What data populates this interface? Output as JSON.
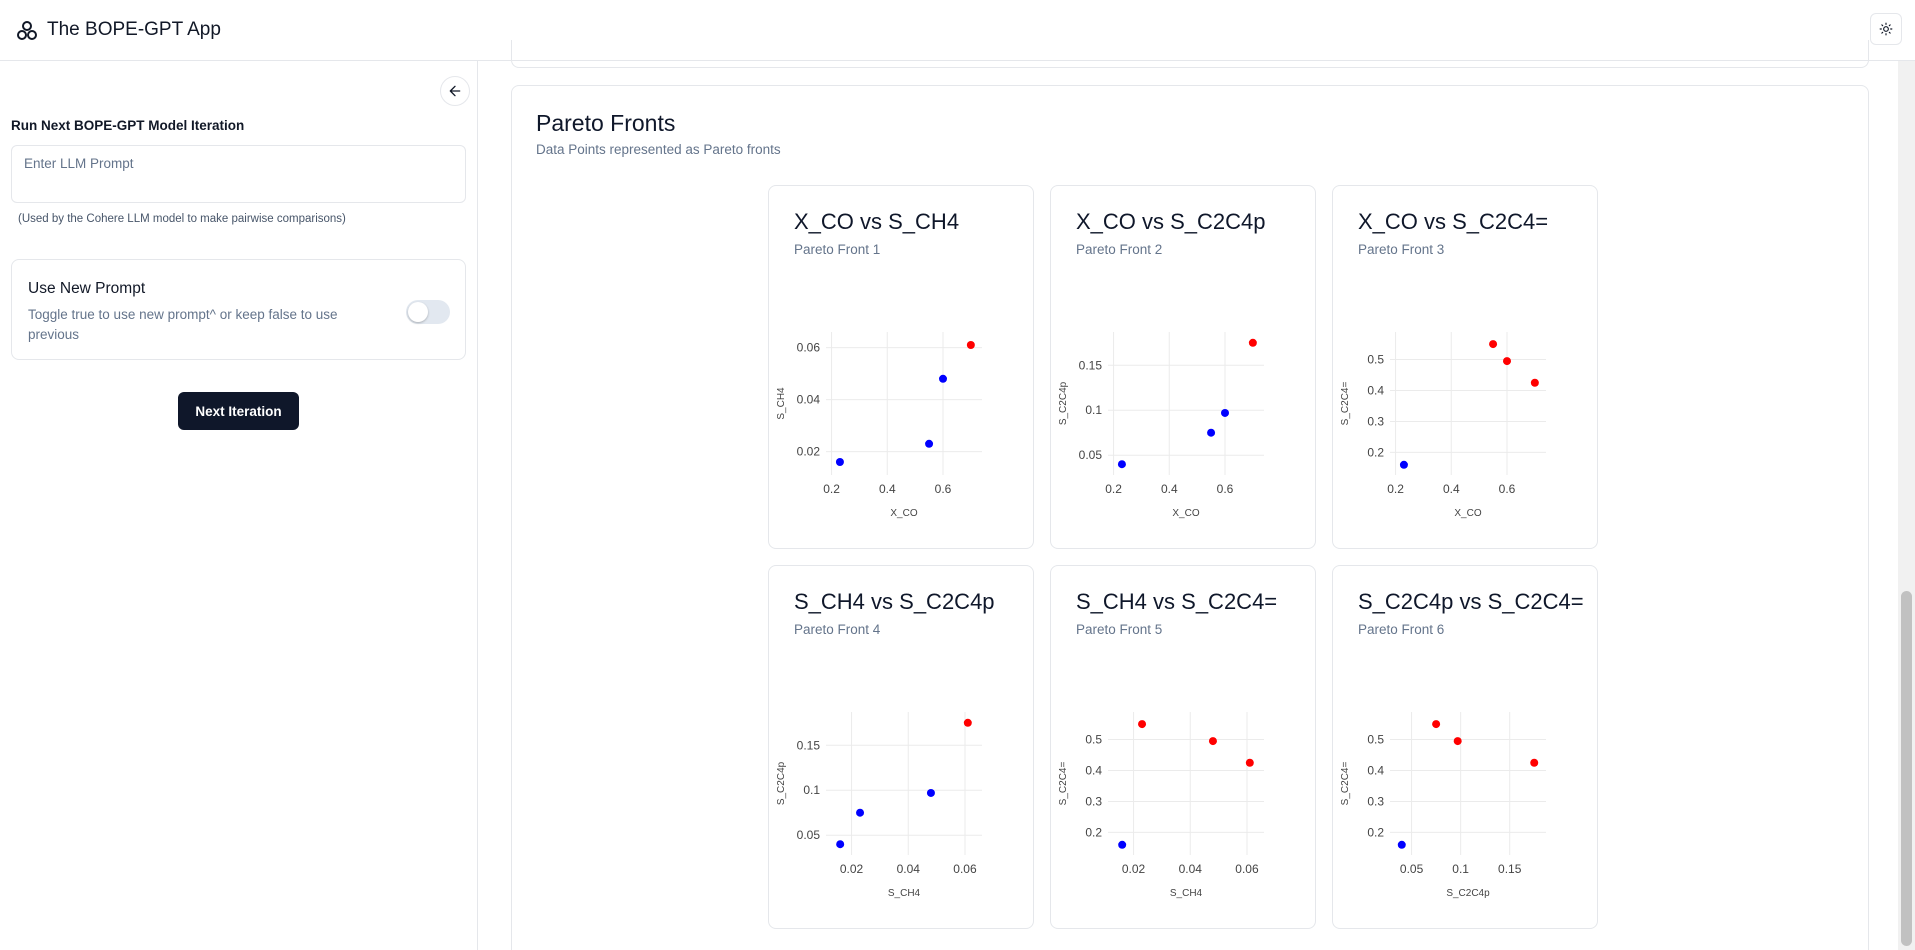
{
  "header": {
    "app_title": "The BOPE-GPT App",
    "logo_icon": "network-logo-icon",
    "theme_icon": "sun-icon"
  },
  "sidebar": {
    "collapse_icon": "arrow-left-icon",
    "run_heading": "Run Next BOPE-GPT Model Iteration",
    "prompt_placeholder": "Enter LLM Prompt",
    "prompt_value": "",
    "prompt_hint": "(Used by the Cohere LLM model to make pairwise comparisons)",
    "toggle_title": "Use New Prompt",
    "toggle_desc": "Toggle true to use new prompt^ or keep false to use previous",
    "toggle_on": false,
    "next_button": "Next Iteration"
  },
  "main": {
    "section_title": "Pareto Fronts",
    "section_sub": "Data Points represented as Pareto fronts"
  },
  "colors": {
    "pareto": "#ff0000",
    "dominated": "#0000ff",
    "primary_button": "#0f172a"
  },
  "chart_data": [
    {
      "type": "scatter",
      "title": "X_CO vs S_CH4",
      "subtitle": "Pareto Front 1",
      "xlabel": "X_CO",
      "ylabel": "S_CH4",
      "xlim": [
        0.18,
        0.74
      ],
      "ylim": [
        0.011,
        0.066
      ],
      "xticks": [
        {
          "v": 0.2,
          "l": "0.2"
        },
        {
          "v": 0.4,
          "l": "0.4"
        },
        {
          "v": 0.6,
          "l": "0.6"
        }
      ],
      "yticks": [
        {
          "v": 0.02,
          "l": "0.02"
        },
        {
          "v": 0.04,
          "l": "0.04"
        },
        {
          "v": 0.06,
          "l": "0.06"
        }
      ],
      "points": [
        {
          "x": 0.7,
          "y": 0.061,
          "pareto": true
        },
        {
          "x": 0.6,
          "y": 0.048,
          "pareto": false
        },
        {
          "x": 0.55,
          "y": 0.023,
          "pareto": false
        },
        {
          "x": 0.23,
          "y": 0.016,
          "pareto": false
        }
      ]
    },
    {
      "type": "scatter",
      "title": "X_CO vs S_C2C4p",
      "subtitle": "Pareto Front 2",
      "xlabel": "X_CO",
      "ylabel": "S_C2C4p",
      "xlim": [
        0.18,
        0.74
      ],
      "ylim": [
        0.028,
        0.187
      ],
      "xticks": [
        {
          "v": 0.2,
          "l": "0.2"
        },
        {
          "v": 0.4,
          "l": "0.4"
        },
        {
          "v": 0.6,
          "l": "0.6"
        }
      ],
      "yticks": [
        {
          "v": 0.05,
          "l": "0.05"
        },
        {
          "v": 0.1,
          "l": "0.1"
        },
        {
          "v": 0.15,
          "l": "0.15"
        }
      ],
      "points": [
        {
          "x": 0.7,
          "y": 0.175,
          "pareto": true
        },
        {
          "x": 0.6,
          "y": 0.097,
          "pareto": false
        },
        {
          "x": 0.55,
          "y": 0.075,
          "pareto": false
        },
        {
          "x": 0.23,
          "y": 0.04,
          "pareto": false
        }
      ]
    },
    {
      "type": "scatter",
      "title": "X_CO vs S_C2C4=",
      "subtitle": "Pareto Front 3",
      "xlabel": "X_CO",
      "ylabel": "S_C2C4=",
      "xlim": [
        0.18,
        0.74
      ],
      "ylim": [
        0.127,
        0.589
      ],
      "xticks": [
        {
          "v": 0.2,
          "l": "0.2"
        },
        {
          "v": 0.4,
          "l": "0.4"
        },
        {
          "v": 0.6,
          "l": "0.6"
        }
      ],
      "yticks": [
        {
          "v": 0.2,
          "l": "0.2"
        },
        {
          "v": 0.3,
          "l": "0.3"
        },
        {
          "v": 0.4,
          "l": "0.4"
        },
        {
          "v": 0.5,
          "l": "0.5"
        }
      ],
      "points": [
        {
          "x": 0.55,
          "y": 0.55,
          "pareto": true
        },
        {
          "x": 0.6,
          "y": 0.495,
          "pareto": true
        },
        {
          "x": 0.7,
          "y": 0.425,
          "pareto": true
        },
        {
          "x": 0.23,
          "y": 0.16,
          "pareto": false
        }
      ]
    },
    {
      "type": "scatter",
      "title": "S_CH4 vs S_C2C4p",
      "subtitle": "Pareto Front 4",
      "xlabel": "S_CH4",
      "ylabel": "S_C2C4p",
      "xlim": [
        0.011,
        0.066
      ],
      "ylim": [
        0.028,
        0.187
      ],
      "xticks": [
        {
          "v": 0.02,
          "l": "0.02"
        },
        {
          "v": 0.04,
          "l": "0.04"
        },
        {
          "v": 0.06,
          "l": "0.06"
        }
      ],
      "yticks": [
        {
          "v": 0.05,
          "l": "0.05"
        },
        {
          "v": 0.1,
          "l": "0.1"
        },
        {
          "v": 0.15,
          "l": "0.15"
        }
      ],
      "points": [
        {
          "x": 0.061,
          "y": 0.175,
          "pareto": true
        },
        {
          "x": 0.048,
          "y": 0.097,
          "pareto": false
        },
        {
          "x": 0.023,
          "y": 0.075,
          "pareto": false
        },
        {
          "x": 0.016,
          "y": 0.04,
          "pareto": false
        }
      ]
    },
    {
      "type": "scatter",
      "title": "S_CH4 vs S_C2C4=",
      "subtitle": "Pareto Front 5",
      "xlabel": "S_CH4",
      "ylabel": "S_C2C4=",
      "xlim": [
        0.011,
        0.066
      ],
      "ylim": [
        0.127,
        0.589
      ],
      "xticks": [
        {
          "v": 0.02,
          "l": "0.02"
        },
        {
          "v": 0.04,
          "l": "0.04"
        },
        {
          "v": 0.06,
          "l": "0.06"
        }
      ],
      "yticks": [
        {
          "v": 0.2,
          "l": "0.2"
        },
        {
          "v": 0.3,
          "l": "0.3"
        },
        {
          "v": 0.4,
          "l": "0.4"
        },
        {
          "v": 0.5,
          "l": "0.5"
        }
      ],
      "points": [
        {
          "x": 0.023,
          "y": 0.55,
          "pareto": true
        },
        {
          "x": 0.048,
          "y": 0.495,
          "pareto": true
        },
        {
          "x": 0.061,
          "y": 0.425,
          "pareto": true
        },
        {
          "x": 0.016,
          "y": 0.16,
          "pareto": false
        }
      ]
    },
    {
      "type": "scatter",
      "title": "S_C2C4p vs S_C2C4=",
      "subtitle": "Pareto Front 6",
      "xlabel": "S_C2C4p",
      "ylabel": "S_C2C4=",
      "xlim": [
        0.028,
        0.187
      ],
      "ylim": [
        0.127,
        0.589
      ],
      "xticks": [
        {
          "v": 0.05,
          "l": "0.05"
        },
        {
          "v": 0.1,
          "l": "0.1"
        },
        {
          "v": 0.15,
          "l": "0.15"
        }
      ],
      "yticks": [
        {
          "v": 0.2,
          "l": "0.2"
        },
        {
          "v": 0.3,
          "l": "0.3"
        },
        {
          "v": 0.4,
          "l": "0.4"
        },
        {
          "v": 0.5,
          "l": "0.5"
        }
      ],
      "points": [
        {
          "x": 0.075,
          "y": 0.55,
          "pareto": true
        },
        {
          "x": 0.097,
          "y": 0.495,
          "pareto": true
        },
        {
          "x": 0.175,
          "y": 0.425,
          "pareto": true
        },
        {
          "x": 0.04,
          "y": 0.16,
          "pareto": false
        }
      ]
    }
  ]
}
